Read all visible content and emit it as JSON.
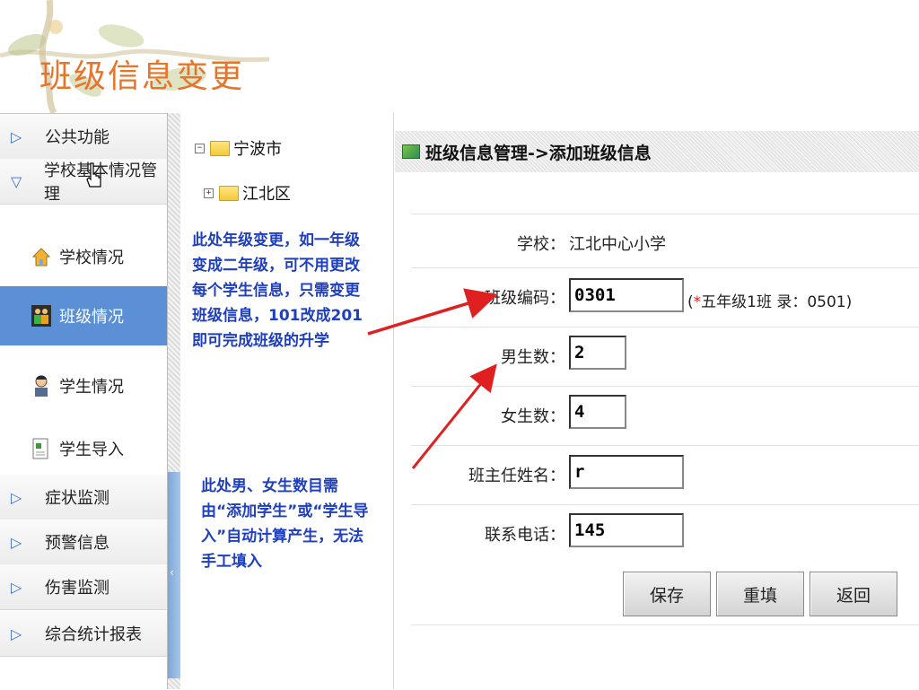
{
  "slide": {
    "title": "班级信息变更"
  },
  "sidebar": {
    "items": [
      {
        "label": "公共功能",
        "expanded": false
      },
      {
        "label": "学校基本情况管理",
        "expanded": true
      },
      {
        "label": "症状监测",
        "expanded": false
      },
      {
        "label": "预警信息",
        "expanded": false
      },
      {
        "label": "伤害监测",
        "expanded": false
      },
      {
        "label": "综合统计报表",
        "expanded": false
      }
    ],
    "subitems": [
      {
        "label": "学校情况",
        "icon": "house-icon",
        "active": false
      },
      {
        "label": "班级情况",
        "icon": "class-icon",
        "active": true
      },
      {
        "label": "学生情况",
        "icon": "student-icon",
        "active": false
      },
      {
        "label": "学生导入",
        "icon": "import-icon",
        "active": false
      }
    ]
  },
  "tree": {
    "root": {
      "toggle": "−",
      "label": "宁波市"
    },
    "child": {
      "toggle": "+",
      "label": "江北区"
    }
  },
  "notes": {
    "note1": "此处年级变更，如一年级变成二年级，可不用更改每个学生信息，只需变更班级信息，101改成201即可完成班级的升学",
    "note2": "此处男、女生数目需由“添加学生”或“学生导入”自动计算产生，无法手工填入"
  },
  "form": {
    "header": "班级信息管理->添加班级信息",
    "school_label": "学校：",
    "school_value": "江北中心小学",
    "class_code_label": "班级编码：",
    "class_code_value": "0301",
    "class_code_hint_star": "*",
    "class_code_hint_text": "五年级1班 录：0501)",
    "class_code_hint_open": "(",
    "boys_label": "男生数：",
    "boys_value": "2",
    "girls_label": "女生数：",
    "girls_value": "4",
    "teacher_label": "班主任姓名：",
    "teacher_value": "r",
    "phone_label": "联系电话：",
    "phone_value": "145",
    "save_label": "保存",
    "reset_label": "重填",
    "back_label": "返回"
  },
  "colors": {
    "title": "#e8742a",
    "note": "#1e3fbf",
    "active": "#5b8fd6",
    "arrow": "#e02020"
  }
}
